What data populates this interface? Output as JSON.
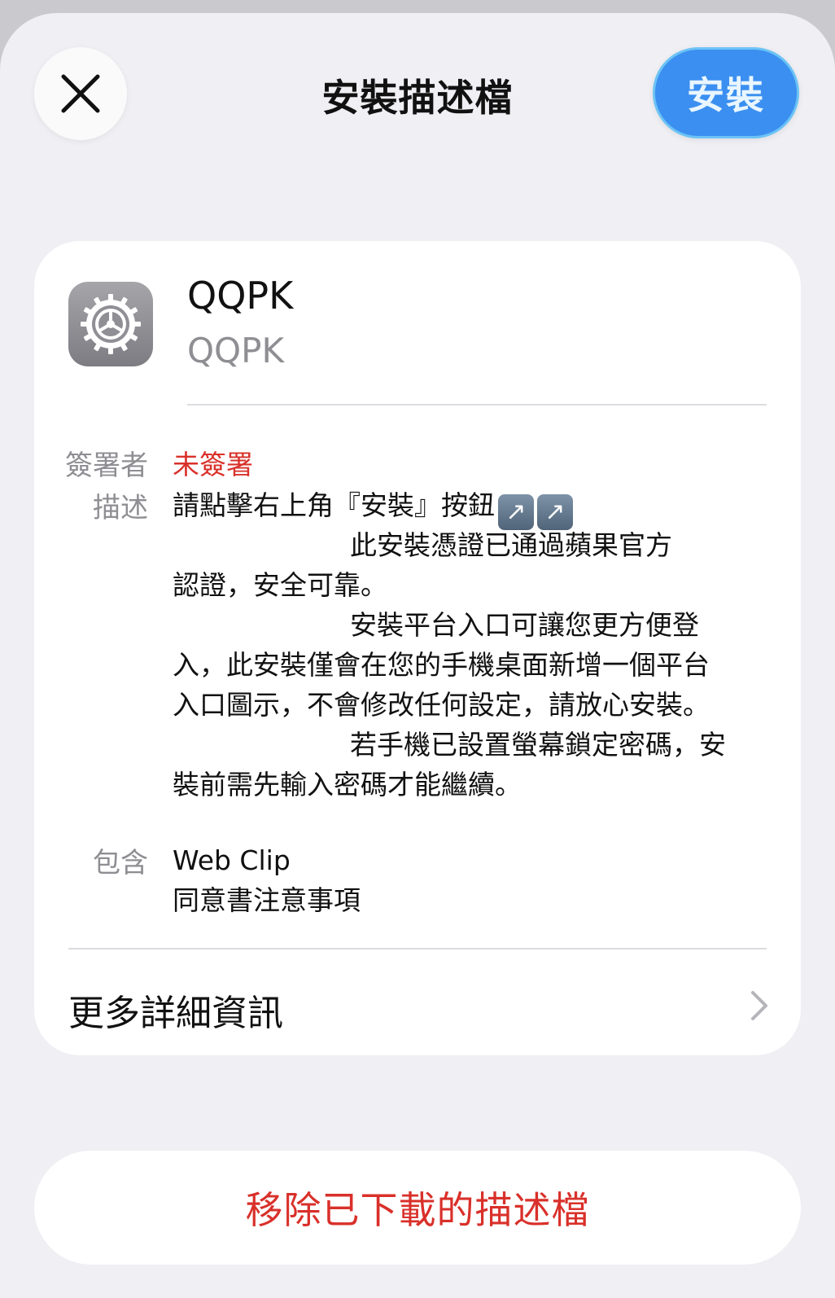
{
  "header": {
    "title": "安裝描述檔",
    "install_label": "安裝"
  },
  "profile": {
    "name": "QQPK",
    "subtitle": "QQPK",
    "icon": "settings-gear-icon"
  },
  "details": {
    "signer_label": "簽署者",
    "signer_value": "未簽署",
    "description_label": "描述",
    "description_lines": [
      "請點擊右上角『安裝』按鈕",
      "此安裝憑證已通過蘋果官方",
      "認證，安全可靠。",
      "安裝平台入口可讓您更方便登",
      "入，此安裝僅會在您的手機桌面新增一個平台",
      "入口圖示，不會修改任何設定，請放心安裝。",
      "若手機已設置螢幕鎖定密碼，安",
      "裝前需先輸入密碼才能繼續。"
    ],
    "contains_label": "包含",
    "contains_items": [
      "Web Clip",
      "同意書注意事項"
    ]
  },
  "more_info_label": "更多詳細資訊",
  "remove_label": "移除已下載的描述檔",
  "colors": {
    "accent_blue": "#3b8ff0",
    "destructive_red": "#d9302a",
    "secondary_gray": "#8e8e93",
    "background": "#efeff4"
  }
}
